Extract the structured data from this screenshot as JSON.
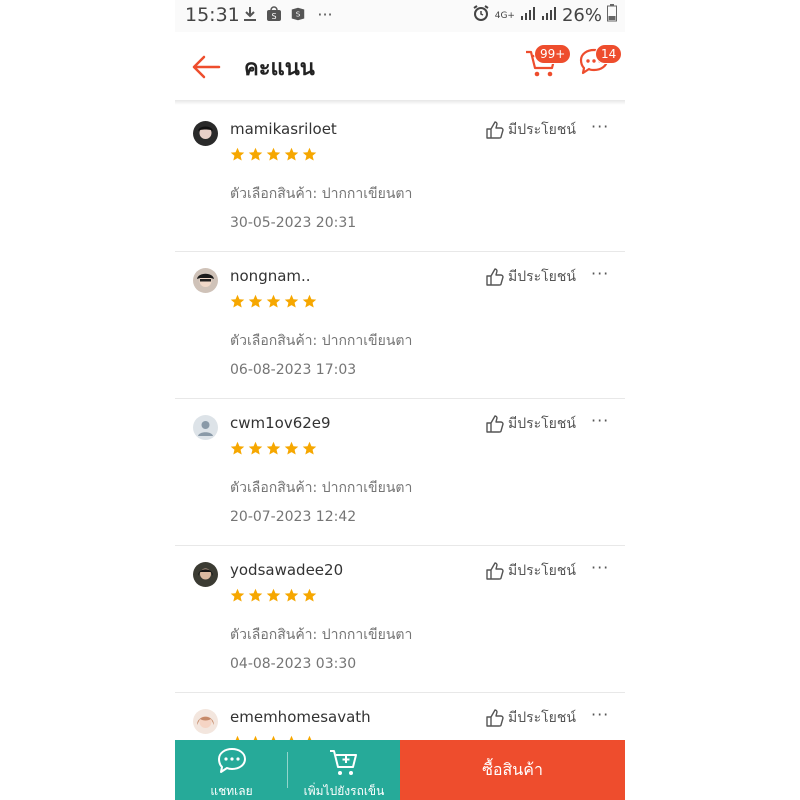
{
  "status_bar": {
    "time": "15:31",
    "battery": "26%",
    "network": "4G+",
    "icons_left": [
      "download-icon",
      "shopee-icon",
      "shopee-bag-icon",
      "more-dots-icon"
    ]
  },
  "header": {
    "title": "คะแนน",
    "cart_badge": "99+",
    "chat_badge": "14",
    "accent_color": "#ee4d2d"
  },
  "reviews": [
    {
      "username": "mamikasriloet",
      "rating": 5,
      "helpful_label": "มีประโยชน์",
      "variation": "ตัวเลือกสินค้า: ปากกาเขียนตา",
      "date": "30-05-2023 20:31"
    },
    {
      "username": "nongnam..",
      "rating": 5,
      "helpful_label": "มีประโยชน์",
      "variation": "ตัวเลือกสินค้า: ปากกาเขียนตา",
      "date": "06-08-2023 17:03"
    },
    {
      "username": "cwm1ov62e9",
      "rating": 5,
      "helpful_label": "มีประโยชน์",
      "variation": "ตัวเลือกสินค้า: ปากกาเขียนตา",
      "date": "20-07-2023 12:42"
    },
    {
      "username": "yodsawadee20",
      "rating": 5,
      "helpful_label": "มีประโยชน์",
      "variation": "ตัวเลือกสินค้า: ปากกาเขียนตา",
      "date": "04-08-2023 03:30"
    },
    {
      "username": "ememhomesavath",
      "rating": 5,
      "helpful_label": "มีประโยชน์",
      "variation": "",
      "date": ""
    }
  ],
  "bottom_bar": {
    "chat_label": "แชทเลย",
    "add_to_cart_label": "เพิ่มไปยังรถเข็น",
    "buy_label": "ซื้อสินค้า",
    "teal_color": "#26aa99",
    "buy_color": "#ee4d2d"
  },
  "star_color": "#f6a700"
}
